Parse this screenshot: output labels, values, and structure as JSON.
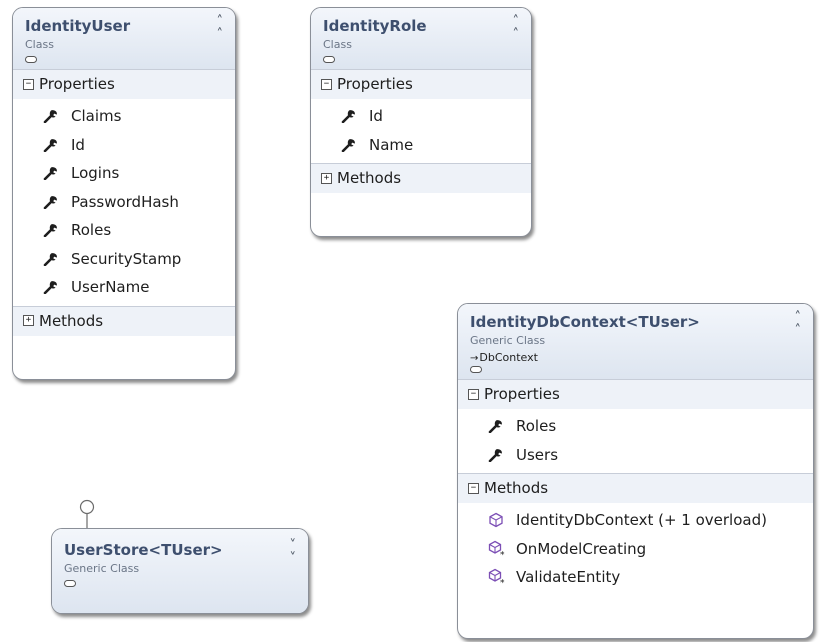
{
  "classes": {
    "identity_user": {
      "name": "IdentityUser",
      "kind": "Class",
      "properties_label": "Properties",
      "properties": [
        "Claims",
        "Id",
        "Logins",
        "PasswordHash",
        "Roles",
        "SecurityStamp",
        "UserName"
      ],
      "methods_label": "Methods"
    },
    "identity_role": {
      "name": "IdentityRole",
      "kind": "Class",
      "properties_label": "Properties",
      "properties": [
        "Id",
        "Name"
      ],
      "methods_label": "Methods"
    },
    "identity_db_context": {
      "name": "IdentityDbContext<TUser>",
      "kind": "Generic Class",
      "base": "DbContext",
      "properties_label": "Properties",
      "properties": [
        "Roles",
        "Users"
      ],
      "methods_label": "Methods",
      "methods": [
        "IdentityDbContext (+ 1 overload)",
        "OnModelCreating",
        "ValidateEntity"
      ]
    },
    "user_store": {
      "name": "UserStore<TUser>",
      "kind": "Generic Class"
    }
  },
  "colors": {
    "header_gradient_top": "#f3f6fb",
    "header_gradient_bottom": "#dde5f0",
    "title_text": "#3e4f6e",
    "section_bg": "#eef2f8",
    "border": "#8a8f98",
    "method_icon": "#7c4fb5"
  },
  "icons": {
    "property": "wrench-icon",
    "method": "method-cube-icon",
    "protected_method": "protected-method-icon",
    "collapse": "double-chevron-up-icon",
    "expand": "double-chevron-down-icon",
    "interface": "lollipop-interface-icon"
  }
}
